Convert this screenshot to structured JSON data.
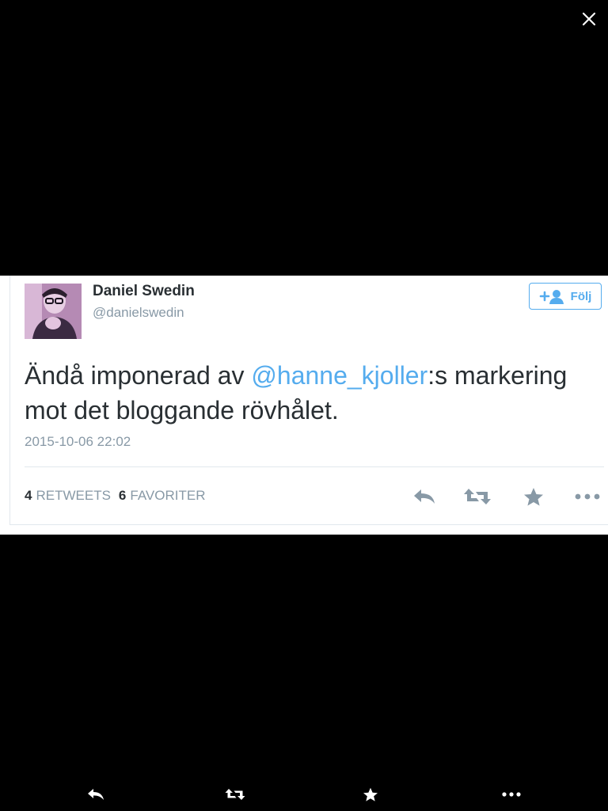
{
  "tweet": {
    "display_name": "Daniel Swedin",
    "handle": "@danielswedin",
    "follow_label": "Följ",
    "text_before": "Ändå imponerad av ",
    "mention": "@hanne_kjoller",
    "text_after": ":s markering mot det bloggande rövhålet.",
    "timestamp": "2015-10-06 22:02",
    "retweets_count": "4",
    "retweets_label": "RETWEETS",
    "favorites_count": "6",
    "favorites_label": "FAVORITER"
  },
  "icons": {
    "close": "close-icon",
    "follow": "add-user-icon",
    "reply": "reply-icon",
    "retweet": "retweet-icon",
    "favorite": "star-icon",
    "more": "more-icon"
  },
  "colors": {
    "accent": "#55acee",
    "text": "#292f33",
    "muted": "#8899a6",
    "background": "#000000"
  }
}
